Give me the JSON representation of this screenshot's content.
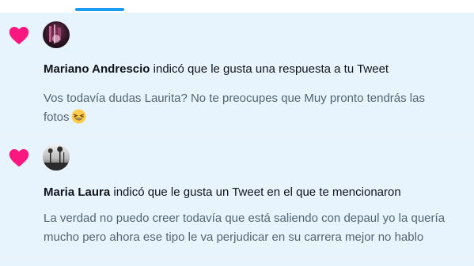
{
  "colors": {
    "accent": "#1d9bf0",
    "heart": "#f91880",
    "background": "#e8f4fd",
    "primary_text": "#0f1419",
    "secondary_text": "#536471"
  },
  "notifications": [
    {
      "icon": "heart-icon",
      "actor": "Mariano Andrescio",
      "action": "indicó que le gusta una respuesta a tu Tweet",
      "text_lines": [
        "Vos todavía dudas Laurita? No te preocupes que Muy pronto tendrás las",
        "fotos"
      ],
      "emoji": "😆"
    },
    {
      "icon": "heart-icon",
      "actor": "Maria Laura",
      "action": "indicó que le gusta un Tweet en el que te mencionaron",
      "text_lines": [
        "La verdad no puedo creer todavía que está saliendo con depaul yo la quería",
        "mucho pero ahora ese tipo le va perjudicar en su carrera mejor no hablo"
      ]
    }
  ]
}
